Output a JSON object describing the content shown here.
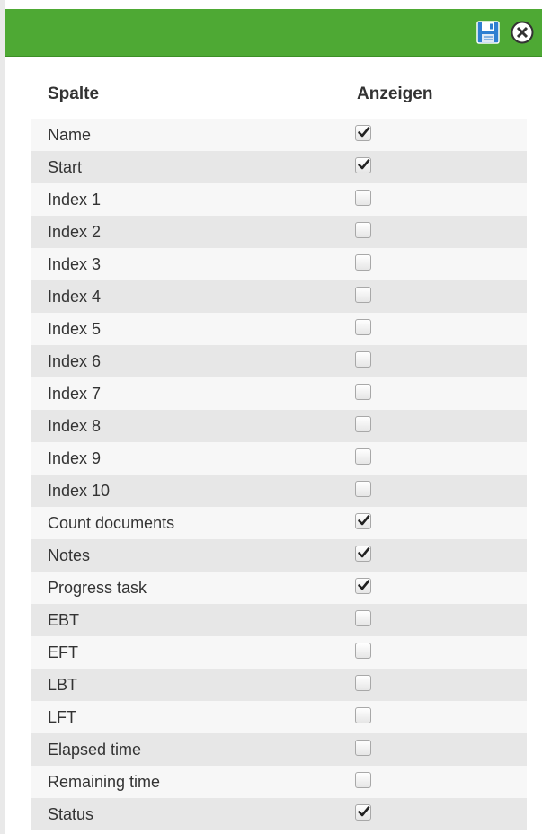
{
  "table": {
    "column_header_name": "Spalte",
    "column_header_show": "Anzeigen",
    "rows": [
      {
        "label": "Name",
        "checked": true
      },
      {
        "label": "Start",
        "checked": true
      },
      {
        "label": "Index 1",
        "checked": false
      },
      {
        "label": "Index 2",
        "checked": false
      },
      {
        "label": "Index 3",
        "checked": false
      },
      {
        "label": "Index 4",
        "checked": false
      },
      {
        "label": "Index 5",
        "checked": false
      },
      {
        "label": "Index 6",
        "checked": false
      },
      {
        "label": "Index 7",
        "checked": false
      },
      {
        "label": "Index 8",
        "checked": false
      },
      {
        "label": "Index 9",
        "checked": false
      },
      {
        "label": "Index 10",
        "checked": false
      },
      {
        "label": "Count documents",
        "checked": true
      },
      {
        "label": "Notes",
        "checked": true
      },
      {
        "label": "Progress task",
        "checked": true
      },
      {
        "label": "EBT",
        "checked": false
      },
      {
        "label": "EFT",
        "checked": false
      },
      {
        "label": "LBT",
        "checked": false
      },
      {
        "label": "LFT",
        "checked": false
      },
      {
        "label": "Elapsed time",
        "checked": false
      },
      {
        "label": "Remaining time",
        "checked": false
      },
      {
        "label": "Status",
        "checked": true
      }
    ]
  },
  "toolbar": {
    "save_icon": "floppy-disk-icon",
    "close_icon": "circle-x-close-icon"
  },
  "colors": {
    "titlebar": "#4ea934",
    "save_icon_blue": "#2f7fd1",
    "row_alt": "#e7e7e7",
    "row_plain": "#f7f7f7"
  }
}
